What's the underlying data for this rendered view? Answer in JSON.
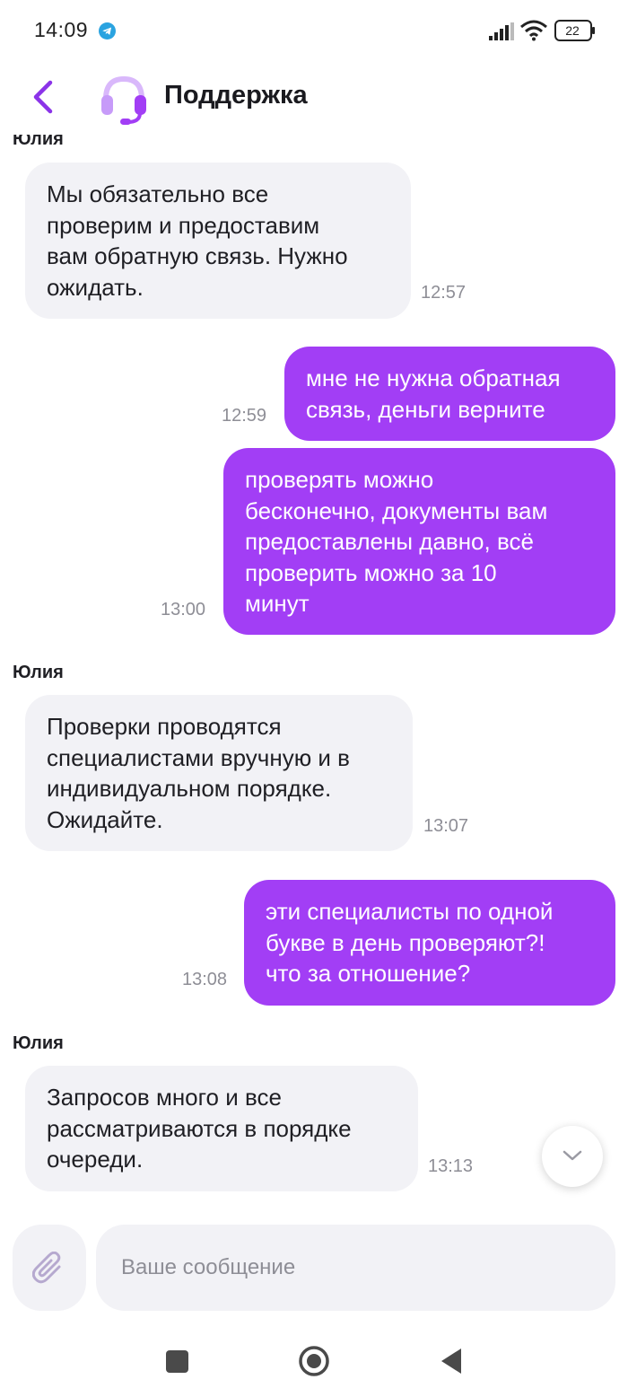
{
  "status_bar": {
    "time": "14:09",
    "battery": "22"
  },
  "header": {
    "title": "Поддержка"
  },
  "messages": [
    {
      "sender": "Юлия",
      "direction": "in",
      "lines": [
        "Мы обязательно все",
        "проверим и предоставим",
        "вам обратную связь. Нужно",
        "ожидать."
      ],
      "time": "12:57"
    },
    {
      "direction": "out",
      "lines": [
        "мне не нужна обратная",
        "связь, деньги верните"
      ],
      "time": "12:59"
    },
    {
      "direction": "out",
      "lines": [
        "проверять можно",
        "бесконечно, документы вам",
        "предоставлены давно, всё",
        "проверить можно за 10",
        "минут"
      ],
      "time": "13:00"
    },
    {
      "sender": "Юлия",
      "direction": "in",
      "lines": [
        "Проверки проводятся",
        "специалистами вручную и в",
        "индивидуальном порядке.",
        "Ожидайте."
      ],
      "time": "13:07"
    },
    {
      "direction": "out",
      "lines": [
        "эти специалисты по одной",
        "букве в день проверяют?!",
        "что за отношение?"
      ],
      "time": "13:08"
    },
    {
      "sender": "Юлия",
      "direction": "in",
      "lines": [
        "Запросов много и все",
        "рассматриваются в порядке",
        "очереди."
      ],
      "time": "13:13"
    }
  ],
  "composer": {
    "placeholder": "Ваше сообщение"
  },
  "icons": {
    "back": "chevron-left-icon",
    "avatar": "headset-icon",
    "scroll": "chevron-down-icon",
    "attach": "paperclip-icon"
  },
  "colors": {
    "accent": "#a23ef5",
    "bubble_in": "#f2f2f6",
    "time_text": "#8e8e96"
  }
}
